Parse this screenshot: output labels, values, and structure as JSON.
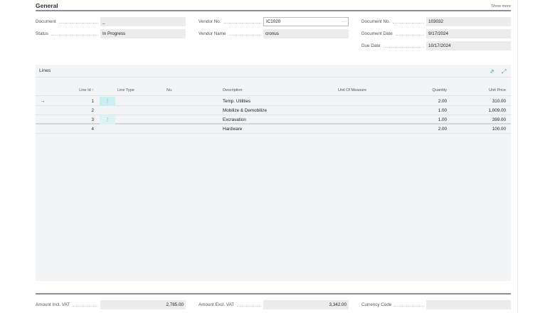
{
  "general": {
    "title": "General",
    "show_more": "Show more",
    "fields": {
      "document": {
        "label": "Document",
        "value": "_"
      },
      "status": {
        "label": "Status",
        "value": "In Progress"
      },
      "vendor_no": {
        "label": "Vendor No.",
        "value": "IC1020"
      },
      "vendor_name": {
        "label": "Vendor Name",
        "value": "cronus"
      },
      "document_no": {
        "label": "Document No.",
        "value": "103032"
      },
      "document_date": {
        "label": "Document Date",
        "value": "9/17/2024"
      },
      "due_date": {
        "label": "Due Date",
        "value": "10/17/2024"
      }
    }
  },
  "lines": {
    "title": "Lines",
    "columns": {
      "line_id": "Line Id ↑",
      "line_type": "Line Type",
      "no": "No.",
      "description": "Description",
      "uom": "Unit Of Measure",
      "quantity": "Quantity",
      "unit_price": "Unit Price"
    },
    "rows": [
      {
        "line_id": "1",
        "description": "Temp. Utilities",
        "quantity": "2.00",
        "unit_price": "310.00"
      },
      {
        "line_id": "2",
        "description": "Mobilize & Demobilize",
        "quantity": "1.00",
        "unit_price": "1,009.00"
      },
      {
        "line_id": "3",
        "description": "Excravation",
        "quantity": "1.00",
        "unit_price": "399.00"
      },
      {
        "line_id": "4",
        "description": "Hardware",
        "quantity": "2.00",
        "unit_price": "100.00"
      }
    ]
  },
  "totals": {
    "amount_incl_vat": {
      "label": "Amount Incl. VAT",
      "value": "2,785.00"
    },
    "amount_excl_vat": {
      "label": "Amount Excl. VAT",
      "value": "3,342.00"
    },
    "currency_code": {
      "label": "Currency Code",
      "value": ""
    }
  }
}
